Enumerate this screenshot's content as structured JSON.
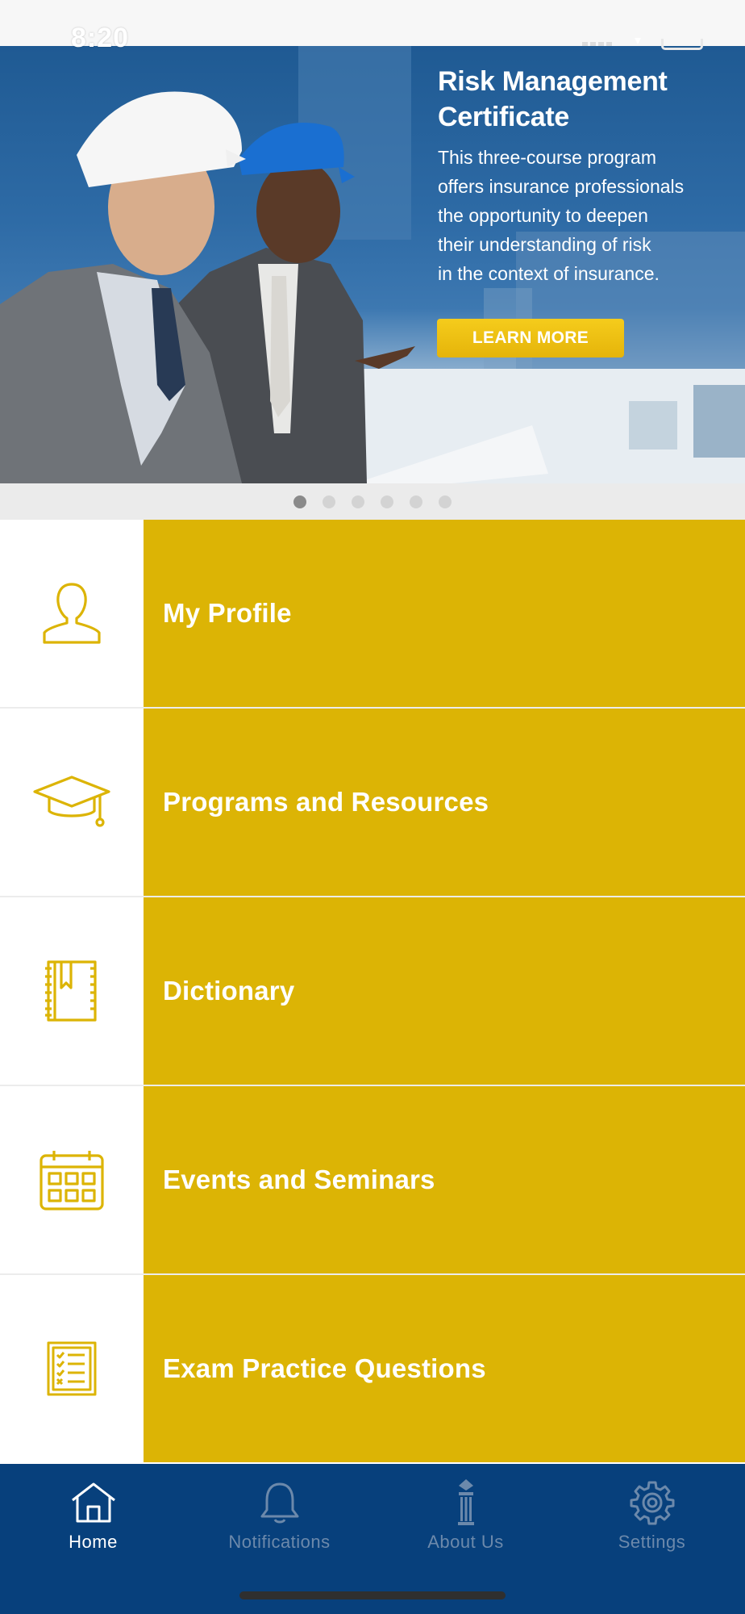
{
  "status_bar": {
    "time": "8:20"
  },
  "carousel": {
    "title_line1": "Risk Management",
    "title_line2": "Certificate",
    "description_lines": [
      "This three-course program",
      "offers insurance professionals",
      "the opportunity to deepen",
      "their understanding of risk",
      "in the context of insurance."
    ],
    "button_label": "LEARN MORE",
    "page_count": 6,
    "active_page": 1
  },
  "menu": {
    "items": [
      {
        "label": "My Profile",
        "icon": "person-icon"
      },
      {
        "label": "Programs and Resources",
        "icon": "graduation-cap-icon"
      },
      {
        "label": "Dictionary",
        "icon": "book-icon"
      },
      {
        "label": "Events and Seminars",
        "icon": "calendar-icon"
      },
      {
        "label": "Exam Practice Questions",
        "icon": "checklist-icon"
      }
    ]
  },
  "tab_bar": {
    "tabs": [
      {
        "label": "Home",
        "icon": "home-icon",
        "active": true
      },
      {
        "label": "Notifications",
        "icon": "bell-icon",
        "active": false
      },
      {
        "label": "About Us",
        "icon": "column-icon",
        "active": false
      },
      {
        "label": "Settings",
        "icon": "gear-icon",
        "active": false
      }
    ]
  },
  "colors": {
    "accent_gold": "#dcb405",
    "navy": "#07407c",
    "banner_blue": "#2e6ba6",
    "button_gold": "#edbd10"
  }
}
